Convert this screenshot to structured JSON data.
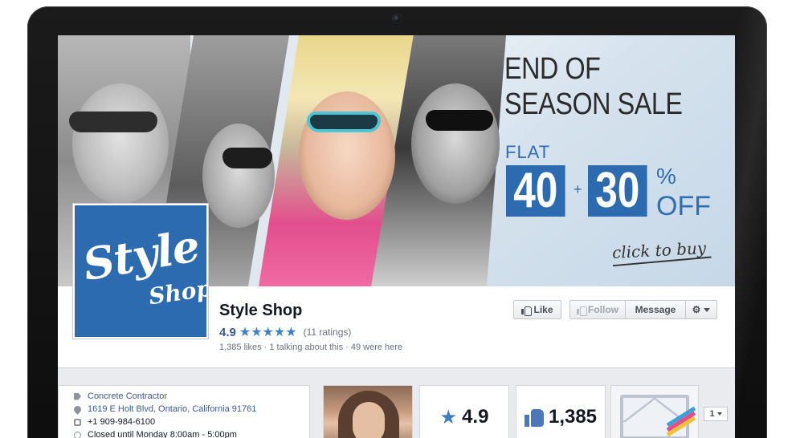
{
  "cover": {
    "headline_line1": "END OF",
    "headline_line2": "SEASON SALE",
    "flat_label": "FLAT",
    "discount_1": "40",
    "plus": "+",
    "discount_2": "30",
    "percent": "%",
    "off": "OFF",
    "cta": "click to buy"
  },
  "profile": {
    "logo_line1": "Style",
    "logo_line2": "Shop",
    "page_name": "Style Shop",
    "rating_value": "4.9",
    "stars": "★★★★★",
    "rating_count": "(11 ratings)",
    "stats": "1,385 likes · 1 talking about this · 49 were here"
  },
  "actions": {
    "like": "Like",
    "follow": "Follow",
    "message": "Message"
  },
  "about": {
    "category": "Concrete Contractor",
    "address": "1619 E Holt Blvd, Ontario, California 91761",
    "phone": "+1 909-984-6100",
    "hours": "Closed until Monday 8:00am - 5:00pm"
  },
  "tiles": {
    "rating": "4.9",
    "likes": "1,385",
    "pager": "1"
  },
  "colors": {
    "brand_blue": "#2c6bb0",
    "fb_link": "#3b5998",
    "star_blue": "#4080c8"
  },
  "icons": [
    "camera-icon",
    "thumbs-up-icon",
    "gear-icon",
    "tag-icon",
    "map-pin-icon",
    "phone-icon",
    "clock-icon",
    "star-icon",
    "envelope-icon",
    "chevron-down-icon"
  ]
}
